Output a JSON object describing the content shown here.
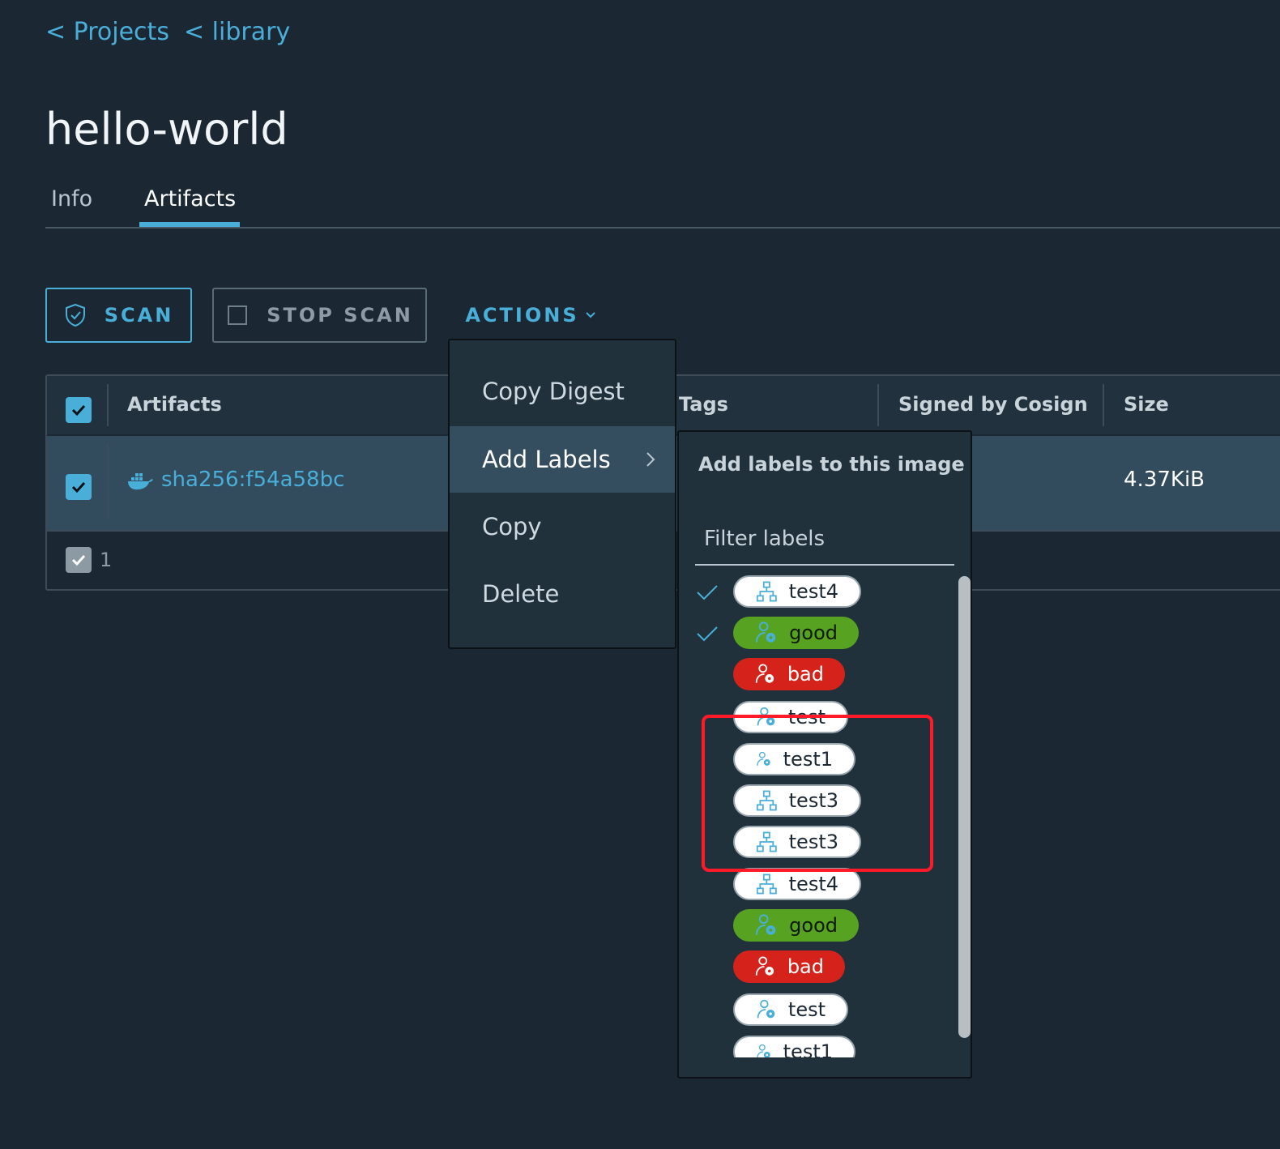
{
  "breadcrumbs": [
    "< Projects",
    "< library"
  ],
  "page_title": "hello-world",
  "tabs": [
    {
      "label": "Info",
      "active": false
    },
    {
      "label": "Artifacts",
      "active": true
    }
  ],
  "toolbar": {
    "scan_label": "SCAN",
    "stop_scan_label": "STOP SCAN",
    "actions_label": "ACTIONS"
  },
  "table": {
    "columns": [
      "Artifacts",
      "Tags",
      "Signed by Cosign",
      "Size"
    ],
    "rows": [
      {
        "artifact": "sha256:f54a58bc",
        "size": "4.37KiB",
        "selected": true
      }
    ],
    "footer_count": "1"
  },
  "actions_menu": {
    "items": [
      "Copy Digest",
      "Add Labels",
      "Copy",
      "Delete"
    ],
    "active_item": "Add Labels"
  },
  "labels_panel": {
    "title": "Add labels to this image",
    "filter_placeholder": "Filter labels",
    "labels": [
      {
        "name": "test4",
        "color": "white",
        "icon": "sitemap-icon",
        "checked": true
      },
      {
        "name": "good",
        "color": "green",
        "icon": "user-gear-icon",
        "checked": true
      },
      {
        "name": "bad",
        "color": "red",
        "icon": "user-gear-icon",
        "checked": false
      },
      {
        "name": "test",
        "color": "white",
        "icon": "user-gear-icon",
        "checked": false
      },
      {
        "name": "test1",
        "color": "white",
        "icon": "user-gear-icon",
        "checked": false
      },
      {
        "name": "test3",
        "color": "white",
        "icon": "sitemap-icon",
        "checked": false
      },
      {
        "name": "test3",
        "color": "white",
        "icon": "sitemap-icon",
        "checked": false
      },
      {
        "name": "test4",
        "color": "white",
        "icon": "sitemap-icon",
        "checked": false
      },
      {
        "name": "good",
        "color": "green",
        "icon": "user-gear-icon",
        "checked": false
      },
      {
        "name": "bad",
        "color": "red",
        "icon": "user-gear-icon",
        "checked": false
      },
      {
        "name": "test",
        "color": "white",
        "icon": "user-gear-icon",
        "checked": false
      },
      {
        "name": "test1",
        "color": "white",
        "icon": "user-gear-icon",
        "checked": false
      }
    ]
  },
  "colors": {
    "accent": "#49afd9",
    "background": "#1b2833",
    "label_green": "#58a222",
    "label_red": "#d5231c",
    "highlight_box": "#ff1a2a"
  }
}
